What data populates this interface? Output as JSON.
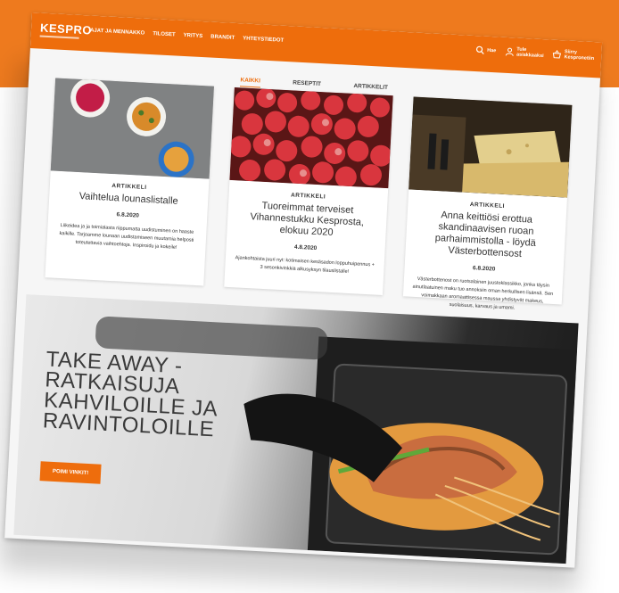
{
  "header": {
    "logo": "KESPRO",
    "nav": [
      "AJAT JA MENNAKKO",
      "TILOSET",
      "YRITYS",
      "BRANDIT",
      "YHTEYSTIEDOT"
    ],
    "utilities": [
      {
        "icon": "search-icon",
        "label": "Hae"
      },
      {
        "icon": "user-icon",
        "label1": "Tule",
        "label2": "asiakkaaksi"
      },
      {
        "icon": "basket-icon",
        "label1": "Siirry",
        "label2": "Kespronetiin"
      }
    ]
  },
  "tabs": [
    "KAIKKI",
    "RESEPTIT",
    "ARTIKKELIT"
  ],
  "active_tab": "KAIKKI",
  "cards": [
    {
      "category": "ARTIKKELI",
      "title": "Vaihtelua lounaslistalle",
      "date": "6.8.2020",
      "description": "Liikeidea ja ja toimialasta riippumatta uudistuminen on haaste kaikille. Tarjoamme lounaan uudistamiseen muutamia helposti toteutettavia vaihtoehtoja. Inspiroidu ja kokeile!"
    },
    {
      "category": "ARTIKKELI",
      "title": "Tuoreimmat terveiset Vihannestukku Kesprosta, elokuu 2020",
      "date": "4.8.2020",
      "description": "Ajankohtaista juuri nyt: kotimaisen kesäsadon loppuhuipennus + 3 sesonkivinkkiä alkusyksyn tilauslistalle!"
    },
    {
      "category": "ARTIKKELI",
      "title": "Anna keittiösi erottua skandinaavisen ruoan parhaimmistolla - löydä Västerbottensost",
      "date": "6.8.2020",
      "description": "Västerbottenost on ruotsalainen juustoklassikko, jonka täysin ainutlaatuinen maku tuo annoksiin oman herkullisen lisänsä. Sen voimakkaan aromaattisessa maussa yhdistyvät makeus, suolaisuus, karvaus ja umami."
    }
  ],
  "hero": {
    "title_lines": [
      "TAKE AWAY -",
      "RATKAISUJA",
      "KAHVILOILLE JA",
      "RAVINTOLOILLE"
    ],
    "button": "POIMI VINKIT!"
  },
  "colors": {
    "brand": "#ee6d0c",
    "background_band": "#ee7a1e"
  }
}
